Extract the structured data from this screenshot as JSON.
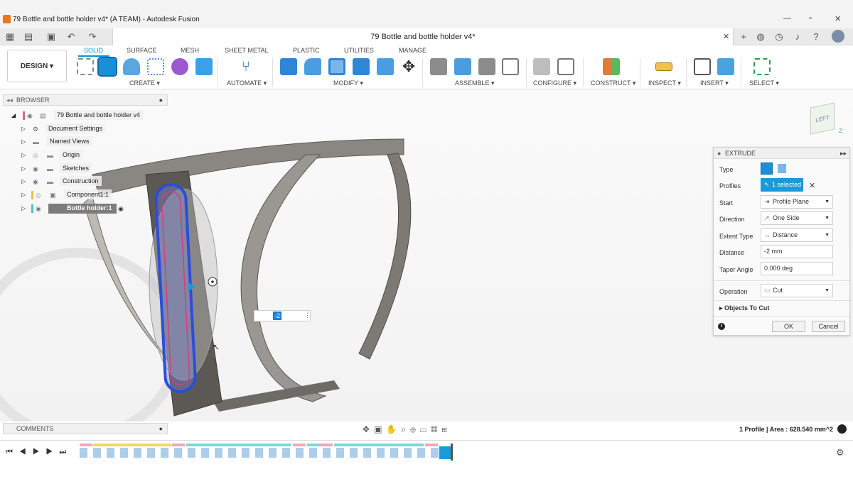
{
  "window": {
    "title": "79 Bottle and bottle holder v4* (A TEAM) - Autodesk Fusion"
  },
  "tabbar": {
    "document_title": "79 Bottle and bottle holder v4*"
  },
  "ribbon": {
    "workspace": "DESIGN",
    "tabs": [
      "SOLID",
      "SURFACE",
      "MESH",
      "SHEET METAL",
      "PLASTIC",
      "UTILITIES",
      "MANAGE"
    ],
    "active_tab": "SOLID",
    "groups": [
      "CREATE",
      "AUTOMATE",
      "MODIFY",
      "ASSEMBLE",
      "CONFIGURE",
      "CONSTRUCT",
      "INSPECT",
      "INSERT",
      "SELECT"
    ]
  },
  "browser": {
    "header": "BROWSER",
    "items": [
      {
        "label": "79 Bottle and bottle holder v4"
      },
      {
        "label": "Document Settings"
      },
      {
        "label": "Named Views"
      },
      {
        "label": "Origin"
      },
      {
        "label": "Sketches"
      },
      {
        "label": "Construction"
      },
      {
        "label": "Component1:1"
      },
      {
        "label": "Bottle holder:1"
      }
    ]
  },
  "comments": {
    "header": "COMMENTS"
  },
  "viewcube": {
    "label": "LEFT",
    "axis": "Z"
  },
  "extrude": {
    "header": "EXTRUDE",
    "fields": {
      "type_label": "Type",
      "profiles_label": "Profiles",
      "profiles_value": "1 selected",
      "start_label": "Start",
      "start_value": "Profile Plane",
      "direction_label": "Direction",
      "direction_value": "One Side",
      "extent_label": "Extent Type",
      "extent_value": "Distance",
      "distance_label": "Distance",
      "distance_value": "-2 mm",
      "taper_label": "Taper Angle",
      "taper_value": "0.000 deg",
      "operation_label": "Operation",
      "operation_value": "Cut",
      "objects_to_cut": "Objects To Cut"
    },
    "ok": "OK",
    "cancel": "Cancel"
  },
  "dimension_input": {
    "value": "-2"
  },
  "status": {
    "profile_info": "1 Profile | Area : 628.540 mm^2"
  },
  "colors": {
    "accent": "#0696d7",
    "selected_chip": "#1a9bd7",
    "profile_blue": "#2a4fd6",
    "profile_pink": "#d0407a"
  }
}
